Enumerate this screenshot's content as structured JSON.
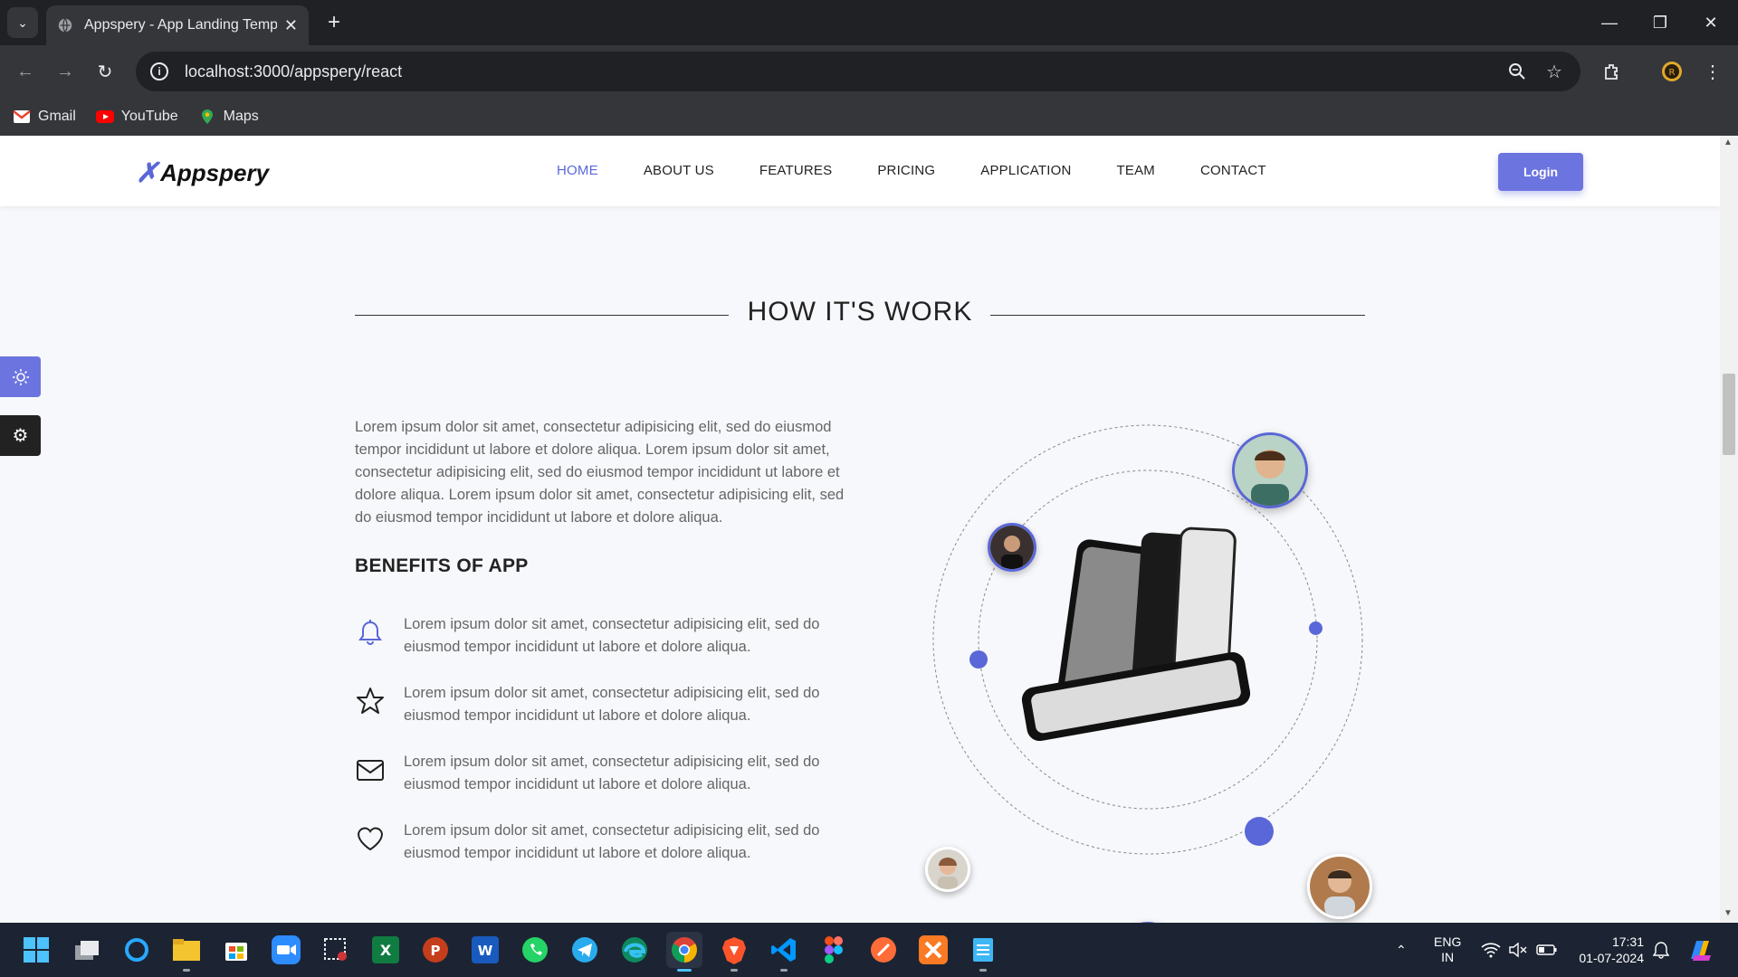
{
  "browser": {
    "tab_title": "Appspery - App Landing Templ",
    "url": "localhost:3000/appspery/react",
    "bookmarks": [
      "Gmail",
      "YouTube",
      "Maps"
    ]
  },
  "site": {
    "logo_text": "Appspery",
    "nav": [
      "HOME",
      "ABOUT US",
      "FEATURES",
      "PRICING",
      "APPLICATION",
      "TEAM",
      "CONTACT"
    ],
    "login_label": "Login",
    "accent_color": "#5a67d8"
  },
  "section": {
    "title": "HOW IT'S WORK",
    "intro": "Lorem ipsum dolor sit amet, consectetur adipisicing elit, sed do eiusmod tempor incididunt ut labore et dolore aliqua. Lorem ipsum dolor sit amet, consectetur adipisicing elit, sed do eiusmod tempor incididunt ut labore et dolore aliqua. Lorem ipsum dolor sit amet, consectetur adipisicing elit, sed do eiusmod tempor incididunt ut labore et dolore aliqua.",
    "benefits_title": "BENEFITS OF APP",
    "benefits": [
      {
        "icon": "bell-icon",
        "text": "Lorem ipsum dolor sit amet, consectetur adipisicing elit, sed do eiusmod tempor incididunt ut labore et dolore aliqua."
      },
      {
        "icon": "star-icon",
        "text": "Lorem ipsum dolor sit amet, consectetur adipisicing elit, sed do eiusmod tempor incididunt ut labore et dolore aliqua."
      },
      {
        "icon": "mail-icon",
        "text": "Lorem ipsum dolor sit amet, consectetur adipisicing elit, sed do eiusmod tempor incididunt ut labore et dolore aliqua."
      },
      {
        "icon": "heart-icon",
        "text": "Lorem ipsum dolor sit amet, consectetur adipisicing elit, sed do eiusmod tempor incididunt ut labore et dolore aliqua."
      }
    ]
  },
  "taskbar": {
    "lang_line1": "ENG",
    "lang_line2": "IN",
    "time": "17:31",
    "date": "01-07-2024"
  }
}
